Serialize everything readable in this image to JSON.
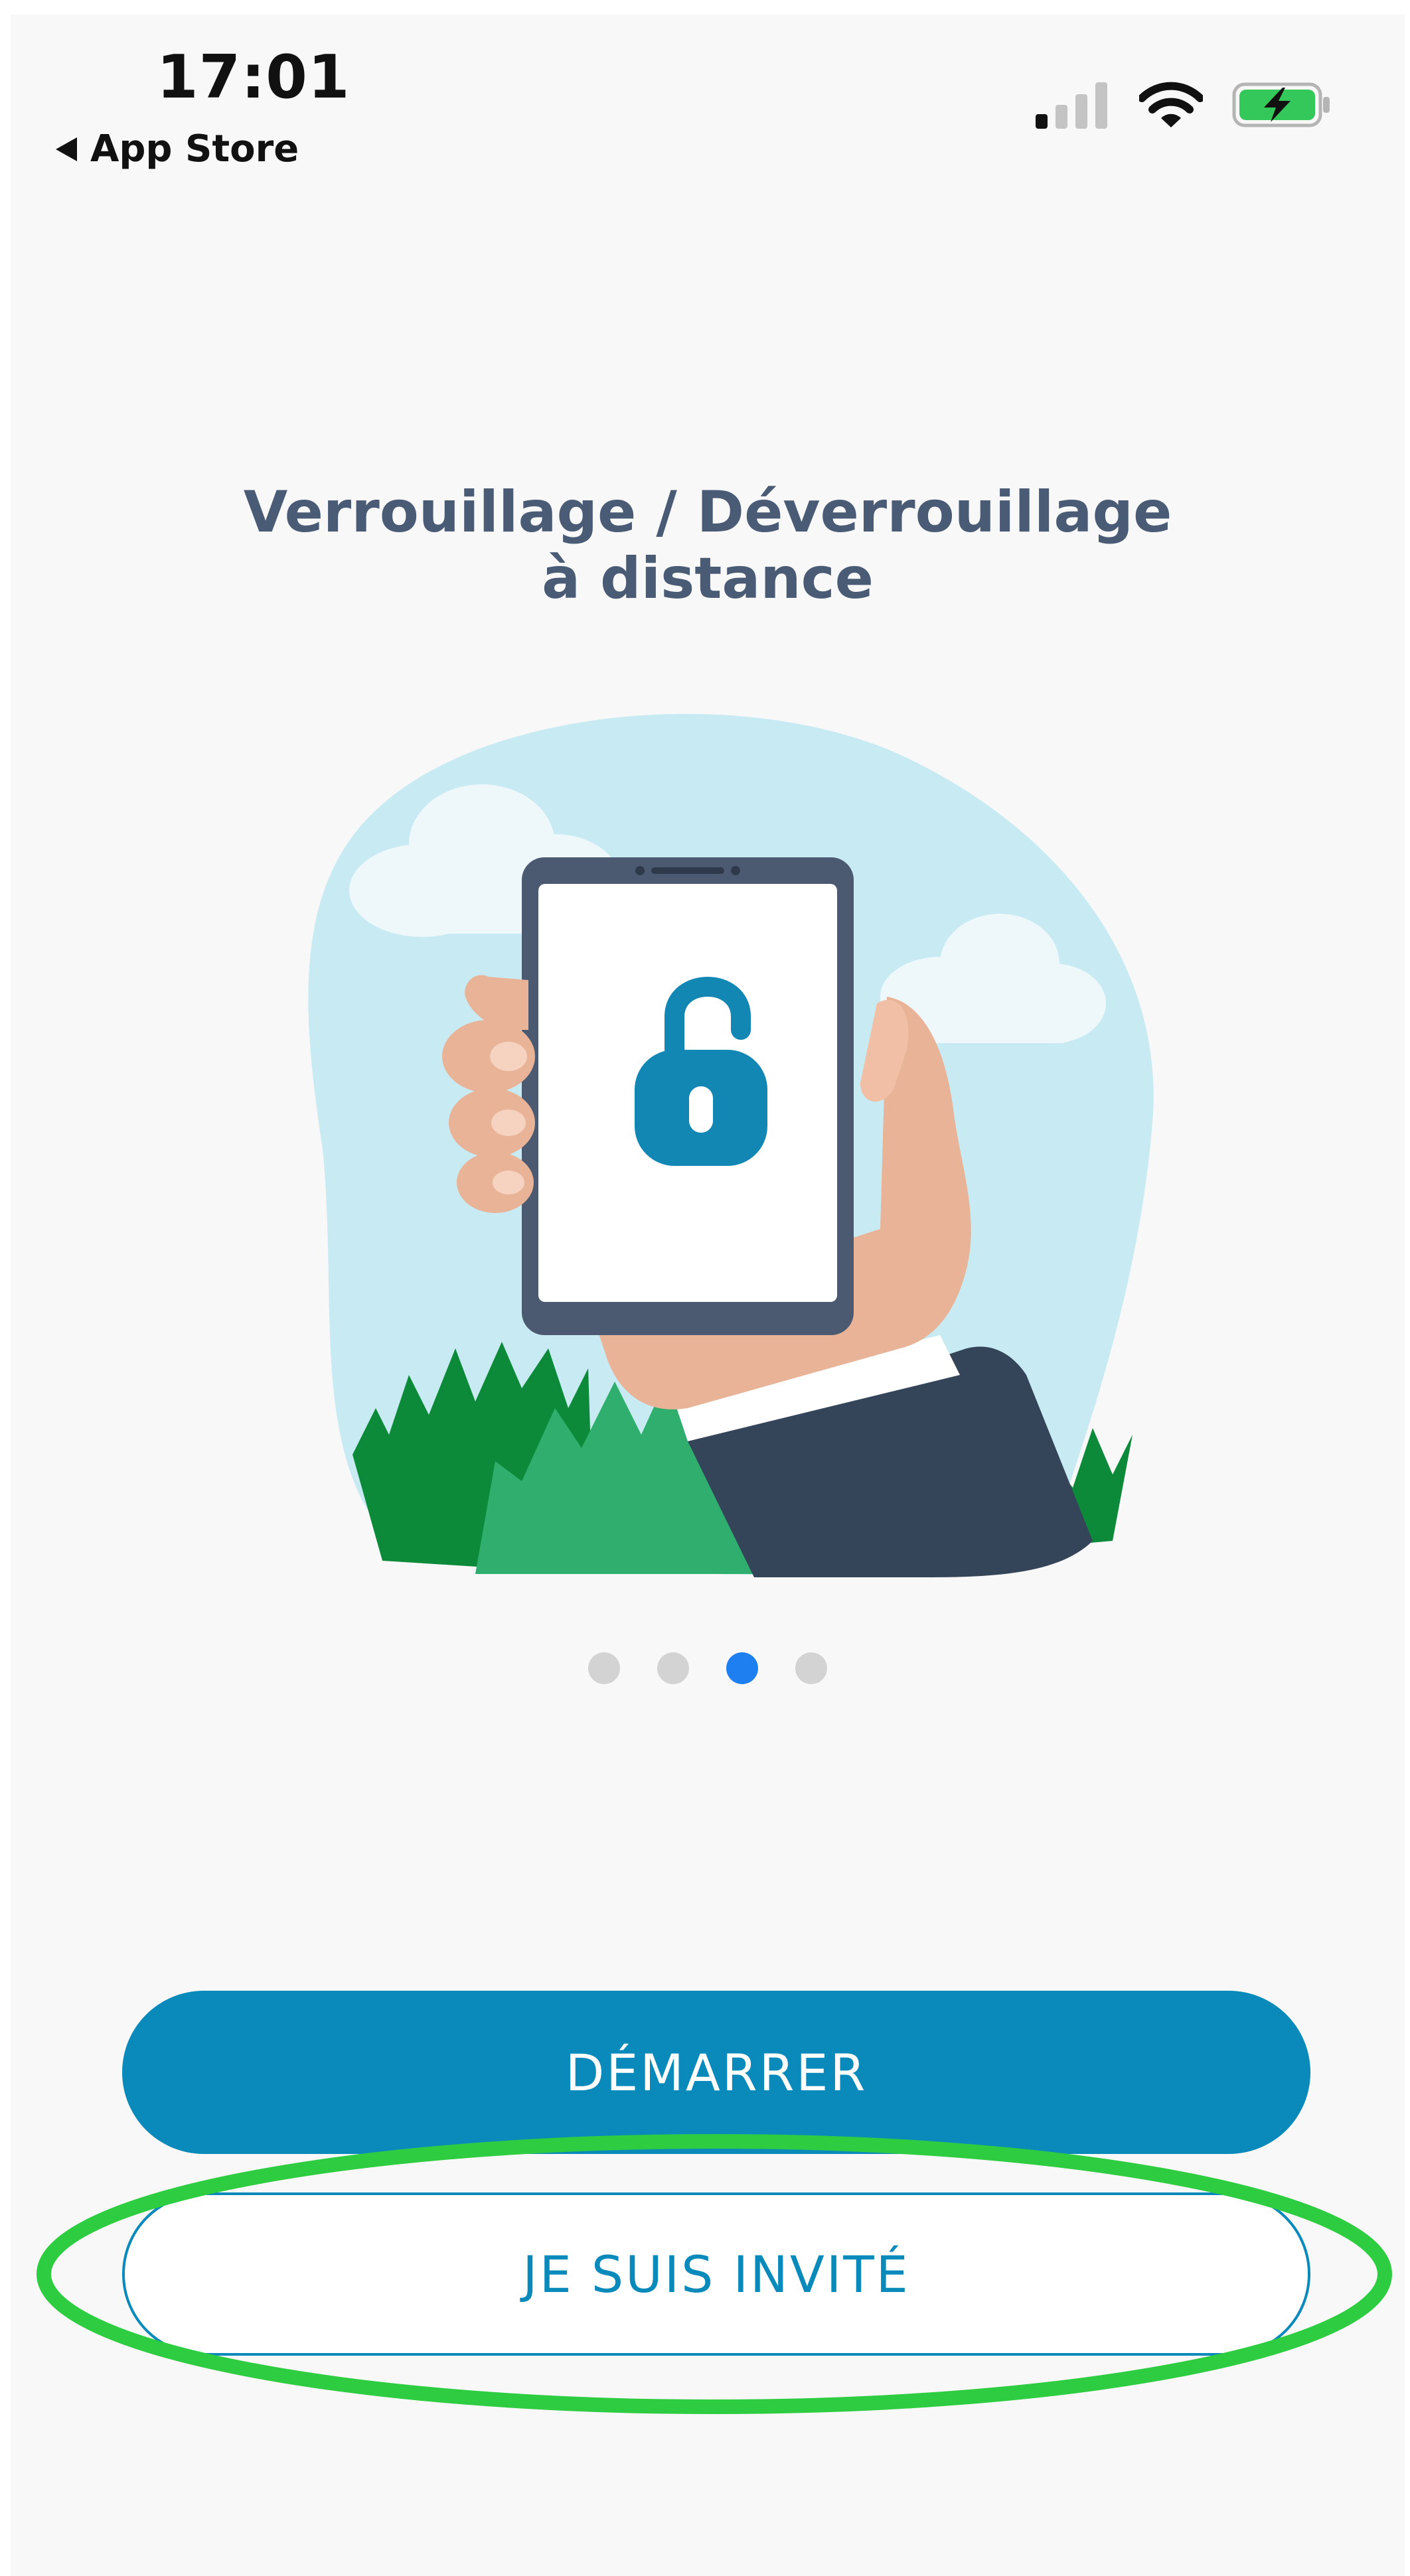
{
  "status_bar": {
    "time": "17:01",
    "back_label": "App Store",
    "icons": [
      "back-arrow-icon",
      "signal-icon",
      "wifi-icon",
      "battery-charging-icon"
    ]
  },
  "onboarding": {
    "title_line1": "Verrouillage / Déverrouillage",
    "title_line2": "à distance",
    "page_count": 4,
    "current_page": 3
  },
  "buttons": {
    "start_label": "DÉMARRER",
    "guest_label": "JE SUIS INVITÉ"
  },
  "colors": {
    "title": "#4a5b75",
    "primary": "#0a8aba",
    "dot_active": "#1e7ff0",
    "dot_inactive": "#d3d3d3",
    "highlight": "#2ecc40",
    "battery": "#34c759"
  }
}
